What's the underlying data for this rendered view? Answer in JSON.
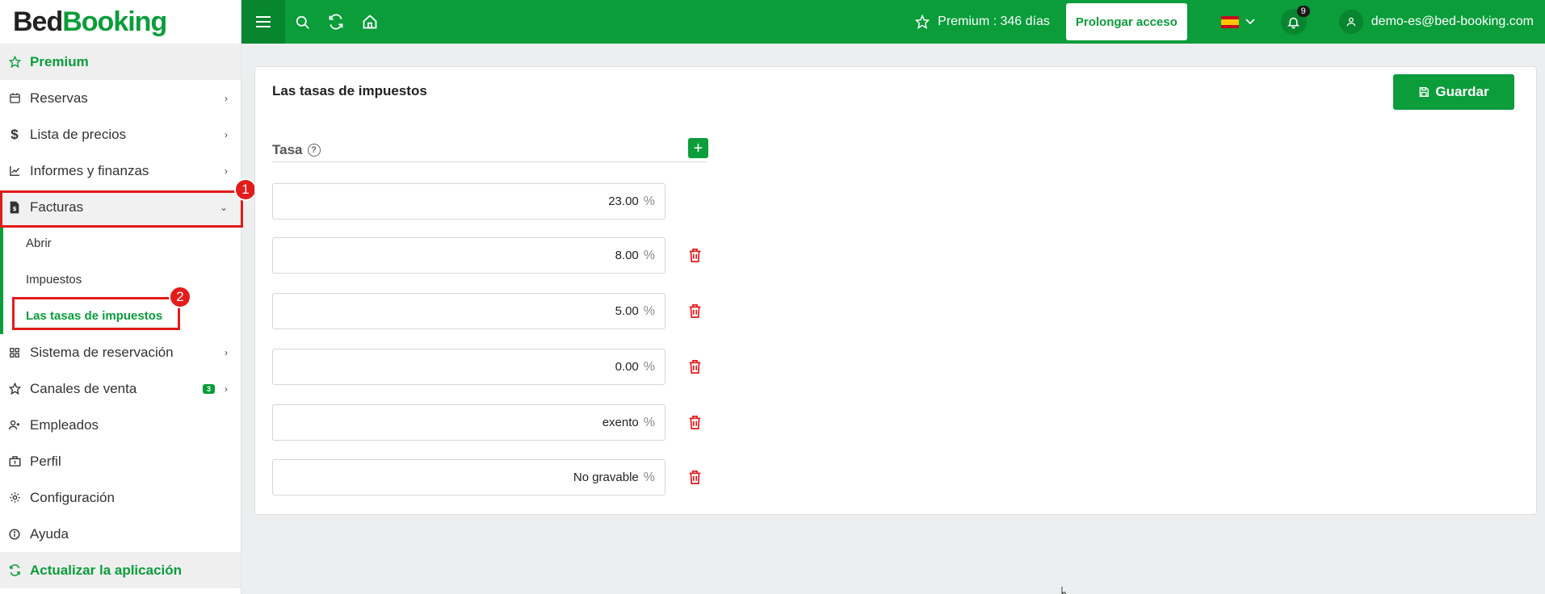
{
  "brand": {
    "part1": "Bed",
    "part2": "Booking"
  },
  "sidebar": {
    "premium": "Premium",
    "items": [
      {
        "label": "Reservas"
      },
      {
        "label": "Lista de precios"
      },
      {
        "label": "Informes y finanzas"
      },
      {
        "label": "Facturas"
      }
    ],
    "facturas_sub": [
      {
        "label": "Abrir"
      },
      {
        "label": "Impuestos"
      },
      {
        "label": "Las tasas de impuestos"
      }
    ],
    "items_after": [
      {
        "label": "Sistema de reservación"
      },
      {
        "label": "Canales de venta",
        "badge": "3"
      },
      {
        "label": "Empleados"
      },
      {
        "label": "Perfil"
      },
      {
        "label": "Configuración"
      },
      {
        "label": "Ayuda"
      }
    ],
    "update": "Actualizar la aplicación"
  },
  "annotations": {
    "step1": "1",
    "step2": "2"
  },
  "topbar": {
    "premium_text": "Premium : 346 días",
    "prolong_label": "Prolongar acceso",
    "notifications_count": "9",
    "user_email": "demo-es@bed-booking.com"
  },
  "content": {
    "title": "Las tasas de impuestos",
    "save_label": "Guardar",
    "column_label": "Tasa",
    "unit": "%",
    "rates": [
      "23.00",
      "8.00",
      "5.00",
      "0.00",
      "exento",
      "No gravable"
    ]
  },
  "colors": {
    "accent": "#0a9d3a",
    "danger": "#e31b1b"
  }
}
